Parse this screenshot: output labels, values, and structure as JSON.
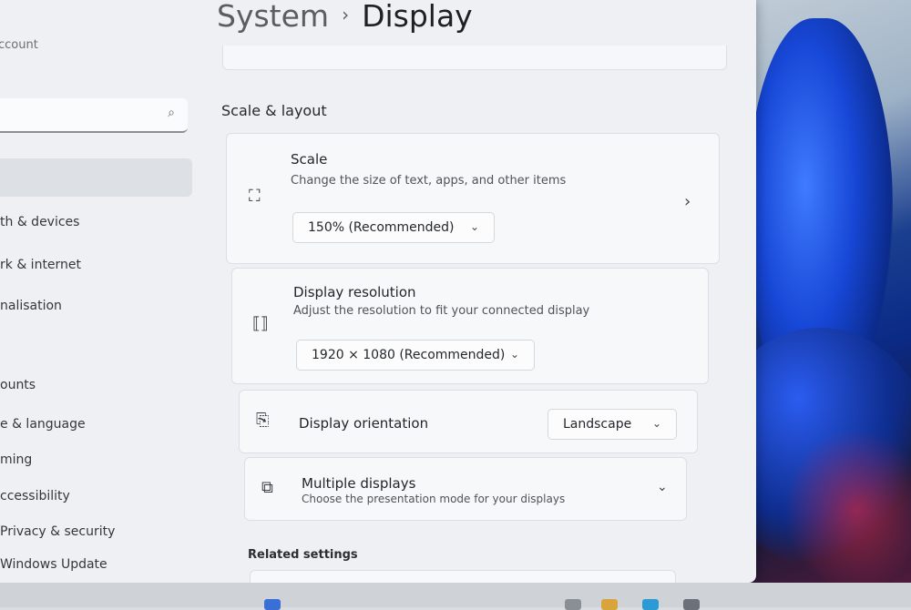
{
  "breadcrumb": {
    "parent": "System",
    "separator": "›",
    "current": "Display"
  },
  "sidebar": {
    "account_label": "ccount",
    "search_placeholder": "",
    "items": [
      {
        "label": "th & devices"
      },
      {
        "label": "rk & internet"
      },
      {
        "label": "nalisation"
      },
      {
        "label": "ounts"
      },
      {
        "label": "e & language"
      },
      {
        "label": "ming"
      },
      {
        "label": "ccessibility"
      },
      {
        "label": "Privacy & security"
      },
      {
        "label": "Windows Update"
      }
    ]
  },
  "section": {
    "title": "Scale & layout"
  },
  "scale": {
    "title": "Scale",
    "description": "Change the size of text, apps, and other items",
    "value": "150% (Recommended)"
  },
  "resolution": {
    "title": "Display resolution",
    "description": "Adjust the resolution to fit your connected display",
    "value": "1920 × 1080 (Recommended)"
  },
  "orientation": {
    "title": "Display orientation",
    "value": "Landscape"
  },
  "multiple_displays": {
    "title": "Multiple displays",
    "description": "Choose the presentation mode for your displays"
  },
  "related_settings": {
    "title": "Related settings"
  },
  "icons": {
    "search": "search-icon",
    "scale": "scale-icon",
    "resolution": "resolution-icon",
    "orientation": "orientation-icon",
    "multiple_displays": "multiple-displays-icon"
  }
}
